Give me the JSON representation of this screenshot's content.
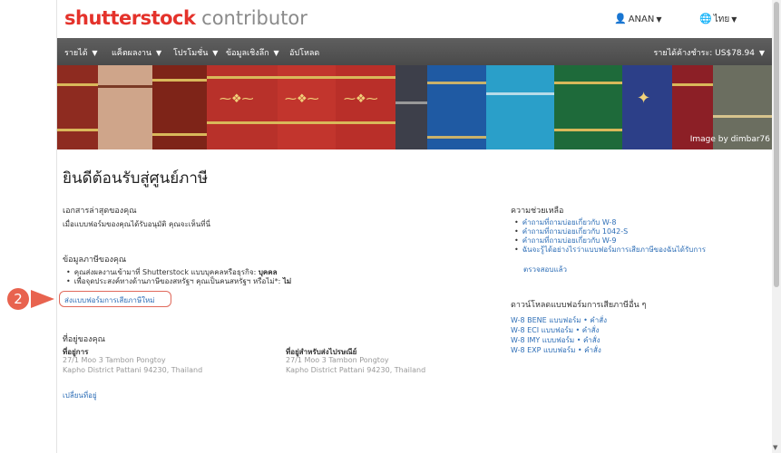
{
  "header": {
    "logo_brand": "shutterstock",
    "logo_sub": " contributor",
    "user_label": "ANAN",
    "language_label": "ไทย"
  },
  "nav": {
    "items": [
      "รายได้",
      "แค็ตผลงาน",
      "โปรโมชั่น",
      "ข้อมูลเชิงลึก",
      "อัปโหลด"
    ],
    "earnings": "รายได้ค้างชำระ: US$78.94"
  },
  "banner": {
    "credit": "Image by dimbar76"
  },
  "main": {
    "title": "ยินดีต้อนรับสู่ศูนย์ภาษี",
    "documents": {
      "heading": "เอกสารล่าสุดของคุณ",
      "text": "เมื่อแบบฟอร์มของคุณได้รับอนุมัติ คุณจะเห็นที่นี่"
    },
    "tax_info": {
      "heading": "ข้อมูลภาษีของคุณ",
      "line1_text": "คุณส่งผลงานเข้ามาที่ Shutterstock แบบบุคคลหรือธุรกิจ: ",
      "line1_value": "บุคคล",
      "line2_text": "เพื่อจุดประสงค์ทางด้านภาษีของสหรัฐฯ คุณเป็นคนสหรัฐฯ หรือไม่*: ",
      "line2_value": "ไม่",
      "new_form_link": "ส่งแบบฟอร์มการเสียภาษีใหม่"
    },
    "address": {
      "heading": "ที่อยู่ของคุณ",
      "office_label": "ที่อยู่การ",
      "office_line1": "27/1 Moo 3 Tambon Pongtoy",
      "office_line2": "Kapho District Pattani 94230, Thailand",
      "mail_label": "ที่อยู่สำหรับส่งไปรษณีย์",
      "mail_line1": "27/1 Moo 3 Tambon Pongtoy",
      "mail_line2": "Kapho District Pattani 94230, Thailand",
      "change_link": "เปลี่ยนที่อยู่"
    },
    "help": {
      "heading": "ความช่วยเหลือ",
      "items": [
        "คำถามที่ถามบ่อยเกี่ยวกับ W-8",
        "คำถามที่ถามบ่อยเกี่ยวกับ 1042-S",
        "คำถามที่ถามบ่อยเกี่ยวกับ W-9",
        "ฉันจะรู้ได้อย่างไรว่าแบบฟอร์มการเสียภาษีของฉันได้รับการ",
        "ตรวจสอบแล้ว"
      ]
    },
    "downloads": {
      "heading": "ดาวน์โหลดแบบฟอร์มการเสียภาษีอื่น ๆ",
      "items": [
        "W-8 BENE แบบฟอร์ม • คำสั่ง",
        "W-8 ECI แบบฟอร์ม • คำสั่ง",
        "W-8 IMY แบบฟอร์ม • คำสั่ง",
        "W-8 EXP แบบฟอร์ม • คำสั่ง"
      ]
    }
  },
  "annotation": {
    "step": "2"
  },
  "colors": {
    "brand": "#e4322b",
    "link": "#2f6fb7",
    "annotation": "#e8634f",
    "nav_bg": "#4f4f4f"
  }
}
